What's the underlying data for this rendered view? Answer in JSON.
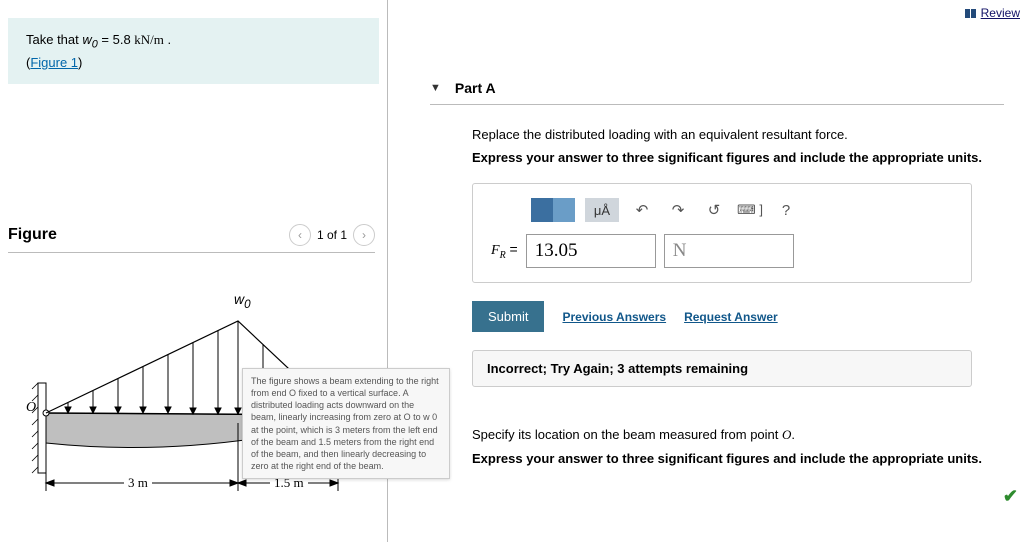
{
  "review_label": "Review",
  "problem": {
    "text_pre": "Take that ",
    "var": "w",
    "sub": "0",
    "eq": " = 5.8 ",
    "unit": "kN/m",
    "post": " .",
    "figure_link": "Figure 1"
  },
  "figure_header": {
    "title": "Figure",
    "pager": "1 of 1"
  },
  "figure_labels": {
    "w0": "w",
    "w0sub": "0",
    "O": "O",
    "d1": "3 m",
    "d2": "1.5 m"
  },
  "tooltip": "The figure shows a beam extending to the right from end O fixed to a vertical surface. A distributed loading acts downward on the beam, linearly increasing from zero at O to w 0 at the point, which is 3 meters from the left end of the beam and 1.5 meters from the right end of the beam, and then linearly decreasing to zero at the right end of the beam.",
  "partA": {
    "label": "Part A",
    "prompt": "Replace the distributed loading with an equivalent resultant force.",
    "instruct": "Express your answer to three significant figures and include the appropriate units.",
    "toolbar": {
      "ua": "μÅ",
      "help": "?"
    },
    "fr_label_pre": "F",
    "fr_label_sub": "R",
    "fr_label_post": " = ",
    "value": "13.05",
    "unit": "N",
    "submit": "Submit",
    "prev": "Previous Answers",
    "req": "Request Answer",
    "feedback": "Incorrect; Try Again; 3 attempts remaining"
  },
  "partB": {
    "prompt_pre": "Specify its location on the beam measured from point ",
    "point": "O",
    "prompt_post": ".",
    "instruct": "Express your answer to three significant figures and include the appropriate units."
  }
}
